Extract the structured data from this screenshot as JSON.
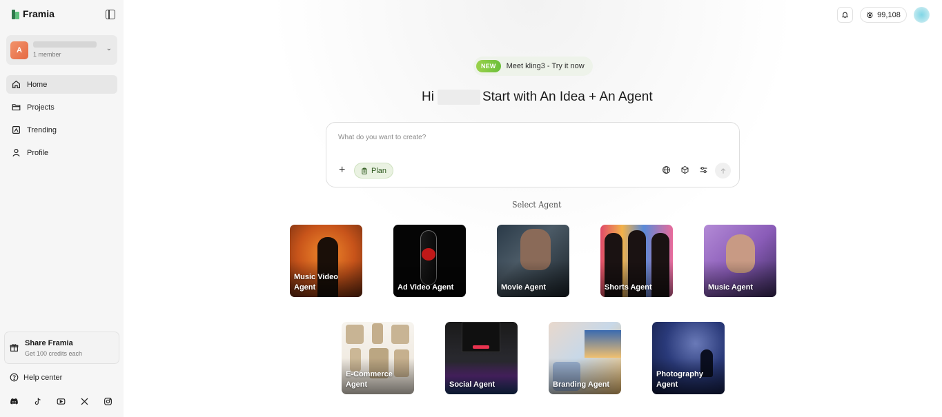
{
  "app": {
    "name": "Framia"
  },
  "workspace": {
    "initial": "A",
    "members": "1 member"
  },
  "nav": {
    "items": [
      {
        "label": "Home",
        "icon": "home-icon"
      },
      {
        "label": "Projects",
        "icon": "folder-icon"
      },
      {
        "label": "Trending",
        "icon": "trending-icon"
      },
      {
        "label": "Profile",
        "icon": "user-icon"
      }
    ]
  },
  "share": {
    "title": "Share Framia",
    "subtitle": "Get 100 credits each"
  },
  "help": {
    "label": "Help center"
  },
  "socials": [
    "discord-icon",
    "tiktok-icon",
    "youtube-icon",
    "x-icon",
    "instagram-icon"
  ],
  "topbar": {
    "credits": "99,108"
  },
  "announcement": {
    "badge": "NEW",
    "text": "Meet kling3 - Try it now"
  },
  "headline": {
    "greeting": "Hi",
    "text": "Start with An Idea + An Agent"
  },
  "composer": {
    "placeholder": "What do you want to create?",
    "plan_label": "Plan"
  },
  "agents": {
    "title": "Select Agent",
    "row1": [
      {
        "label": "Music Video Agent"
      },
      {
        "label": "Ad Video Agent"
      },
      {
        "label": "Movie Agent"
      },
      {
        "label": "Shorts Agent"
      },
      {
        "label": "Music Agent"
      }
    ],
    "row2": [
      {
        "label": "E-Commerce Agent"
      },
      {
        "label": "Social Agent"
      },
      {
        "label": "Branding Agent"
      },
      {
        "label": "Photography Agent"
      }
    ]
  },
  "colors": {
    "accent_green": "#6bbf3a",
    "avatar_orange": "#e56a44"
  }
}
